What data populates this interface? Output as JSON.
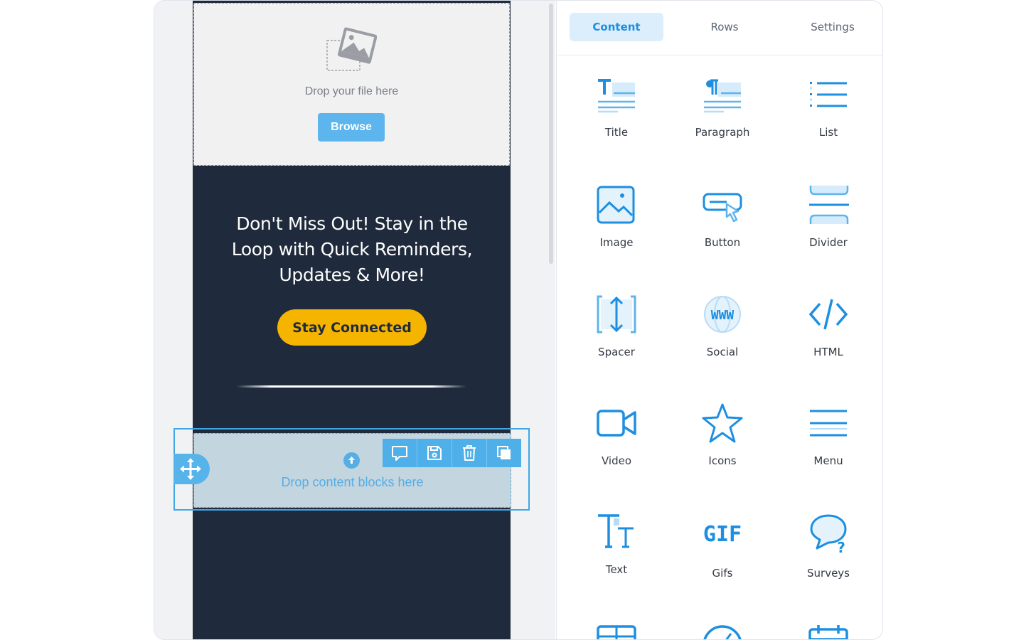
{
  "canvas": {
    "drop_file_text": "Drop your file here",
    "browse_label": "Browse",
    "headline": "Don't Miss Out! Stay in the Loop with Quick Reminders, Updates & More!",
    "cta_label": "Stay Connected",
    "drop_blocks_text": "Drop content blocks here"
  },
  "tabs": [
    {
      "label": "Content",
      "active": true
    },
    {
      "label": "Rows",
      "active": false
    },
    {
      "label": "Settings",
      "active": false
    }
  ],
  "blocks": [
    {
      "label": "Title",
      "icon": "title-icon"
    },
    {
      "label": "Paragraph",
      "icon": "paragraph-icon"
    },
    {
      "label": "List",
      "icon": "list-icon"
    },
    {
      "label": "Image",
      "icon": "image-icon"
    },
    {
      "label": "Button",
      "icon": "button-icon"
    },
    {
      "label": "Divider",
      "icon": "divider-icon"
    },
    {
      "label": "Spacer",
      "icon": "spacer-icon"
    },
    {
      "label": "Social",
      "icon": "social-icon"
    },
    {
      "label": "HTML",
      "icon": "html-icon"
    },
    {
      "label": "Video",
      "icon": "video-icon"
    },
    {
      "label": "Icons",
      "icon": "star-icon"
    },
    {
      "label": "Menu",
      "icon": "menu-icon"
    },
    {
      "label": "Text",
      "icon": "text-icon"
    },
    {
      "label": "Gifs",
      "icon": "gif-icon"
    },
    {
      "label": "Surveys",
      "icon": "survey-icon"
    }
  ],
  "colors": {
    "accent": "#1e8fe0",
    "email_bg": "#1f2a3c",
    "cta": "#f5b400",
    "selection": "#3fa7e6"
  }
}
